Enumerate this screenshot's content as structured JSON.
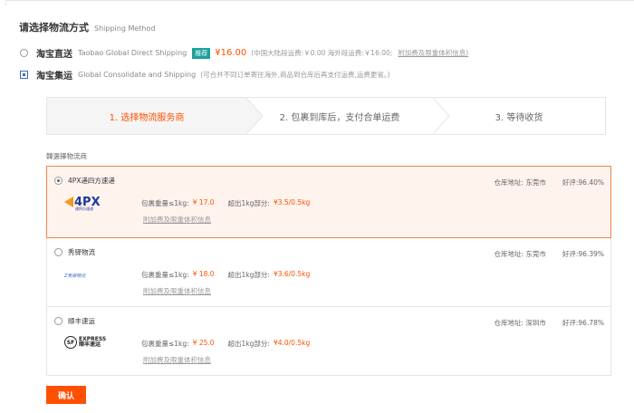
{
  "header": {
    "title": "请选择物流方式",
    "subtitle": "Shipping Method"
  },
  "methods": [
    {
      "name": "淘宝直送",
      "en": "Taobao Global Direct Shipping",
      "tag": "推荐",
      "price": "¥16.00",
      "note": "(中国大陆段运费:￥0.00 海外段运费:￥16.00;",
      "link": "附加费及限重体积信息)",
      "checked": false
    },
    {
      "name": "淘宝集运",
      "en": "Global Consolidate and Shipping",
      "note": "(可合并不同订单寄往海外,商品到合库后再支付运费,运费更省。)",
      "checked": true
    }
  ],
  "steps": [
    "1. 选择物流服务商",
    "2. 包裹到库后，支付合单运费",
    "3. 等待收货"
  ],
  "providers_label": "韓選擇物流商",
  "providers": [
    {
      "name": "4PX递四方速递",
      "warehouse": "仓库地址: 东莞市",
      "rating": "好评:96.40%",
      "first_label": "包裹重量≤1kg:",
      "first_price": "¥ 17.0",
      "extra_label": "超出1kg部分:",
      "extra_price": "¥3.5/0.5kg",
      "link": "附加费及限重体积信息",
      "logo": "4px-logo",
      "logo_text": "4PX",
      "logo_sub": "递四方速递",
      "selected": true
    },
    {
      "name": "秀驿物流",
      "warehouse": "仓库地址: 东莞市",
      "rating": "好评:96.39%",
      "first_label": "包裹重量≤1kg:",
      "first_price": "¥ 18.0",
      "extra_label": "超出1kg部分:",
      "extra_price": "¥3.6/0.5kg",
      "link": "附加费及限重体积信息",
      "logo": "xiuyi-logo",
      "logo_text": "Z秀驿物流",
      "selected": false
    },
    {
      "name": "顺丰速运",
      "warehouse": "仓库地址: 深圳市",
      "rating": "好评:96.78%",
      "first_label": "包裹重量≤1kg:",
      "first_price": "¥ 25.0",
      "extra_label": "超出1kg部分:",
      "extra_price": "¥4.0/0.5kg",
      "link": "附加费及限重体积信息",
      "logo": "sf-express-logo",
      "logo_mark": "SF",
      "logo_line1": "EXPRESS",
      "logo_line2": "顺丰速运",
      "selected": false
    }
  ],
  "confirm_label": "确认",
  "colors": {
    "accent": "#ff5000",
    "tag": "#1aa19a",
    "selected_bg": "#fff3ee",
    "selected_border": "#f2854a"
  }
}
